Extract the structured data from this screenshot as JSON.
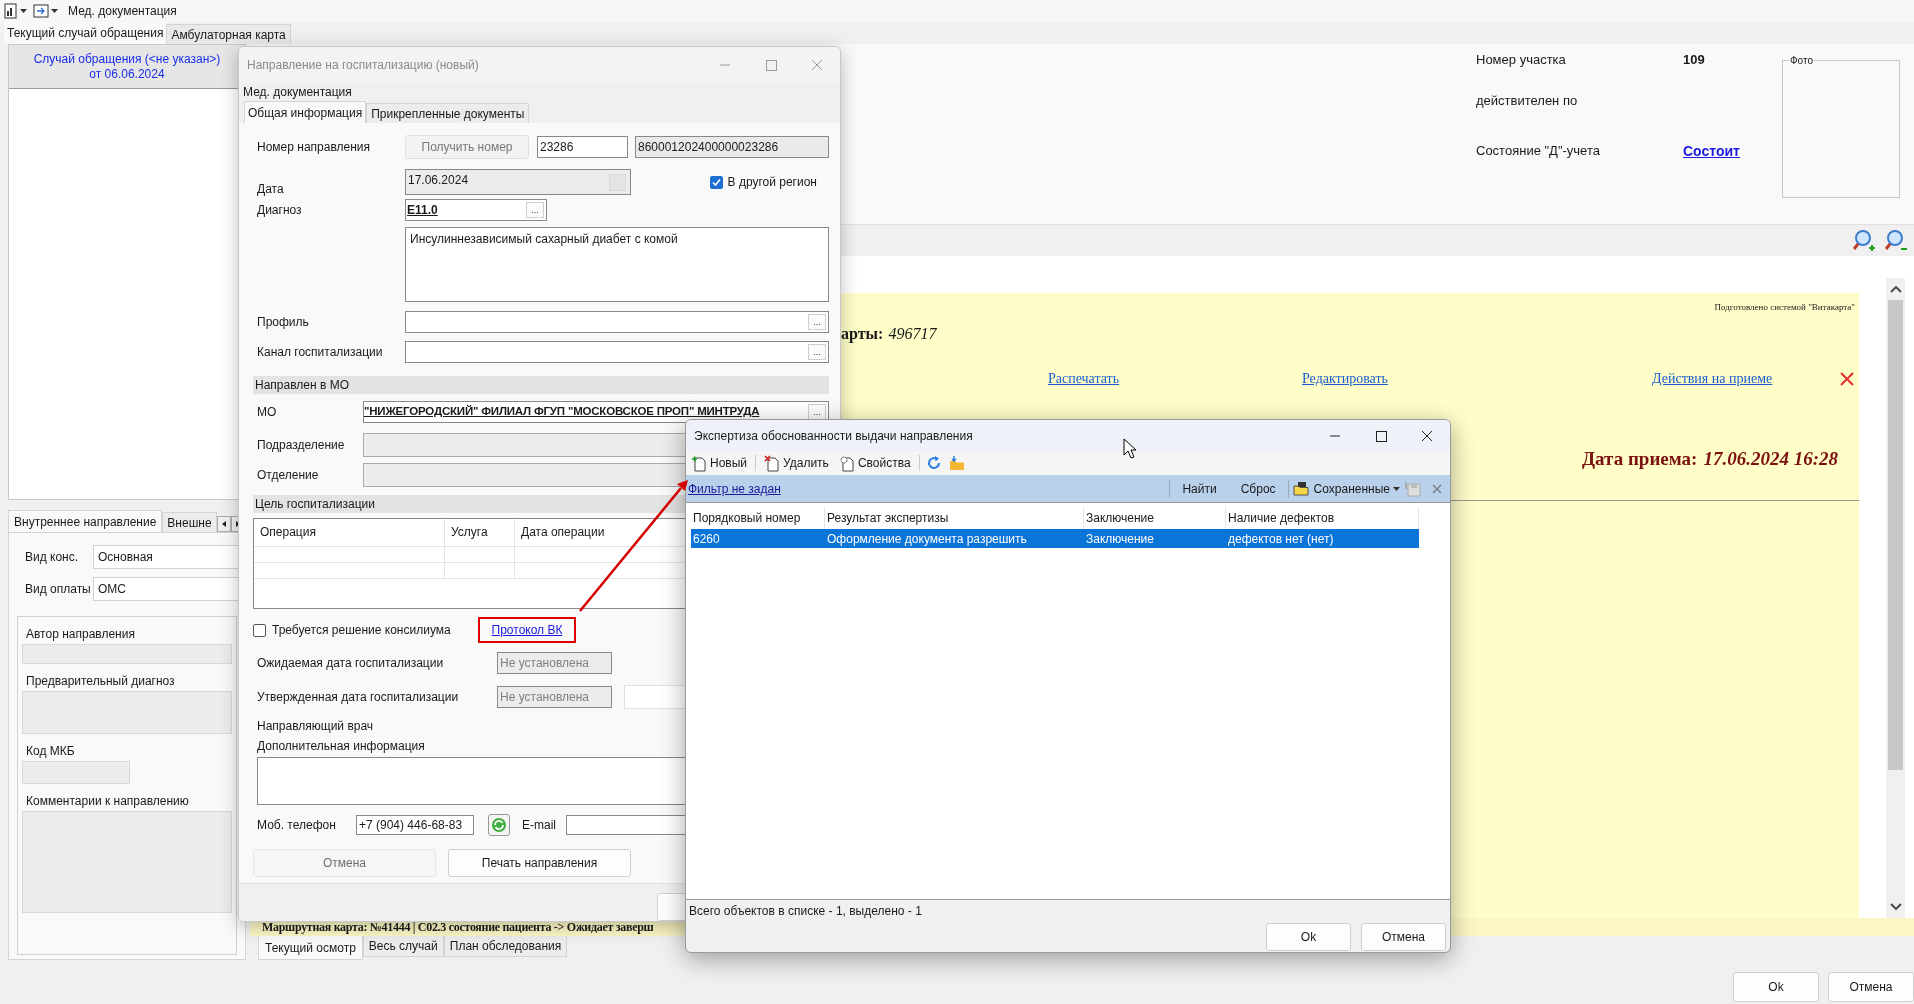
{
  "menu_bar": {
    "title": "Мед. документация"
  },
  "main_tabs": [
    {
      "label": "Текущий случай обращения",
      "selected": true
    },
    {
      "label": "Амбулаторная карта",
      "selected": false
    }
  ],
  "case_header": {
    "line1": "Случай обращения (<не указан>)",
    "line2": "от 06.06.2024"
  },
  "referral_tabs": [
    {
      "label": "Внутреннее направление",
      "selected": true
    },
    {
      "label": "Внешне",
      "selected": false
    }
  ],
  "referral_fields": [
    {
      "label": "Вид конс.",
      "value": "Основная"
    },
    {
      "label": "Вид оплаты",
      "value": "ОМС"
    }
  ],
  "referral_sections": [
    {
      "label": "Автор направления",
      "kind": "short"
    },
    {
      "label": "Предварительный диагноз",
      "kind": "tall"
    },
    {
      "label": "Код МКБ",
      "kind": "narrow"
    },
    {
      "label": "Комментарии к направлению",
      "kind": "large"
    }
  ],
  "patient_info": [
    {
      "label": "Номер участка",
      "value": "109",
      "kind": "bold"
    },
    {
      "label": "действителен по",
      "kind": "empty"
    },
    {
      "label": "Состояние \"Д\"-учета",
      "value": "Состоит",
      "kind": "link"
    }
  ],
  "photo": {
    "label": "Фото"
  },
  "document": {
    "system_note": "Подготовлено системой \"Витакарта\"",
    "card_label": "арты:",
    "card_number": "496717",
    "links": [
      "Распечатать",
      "Редактировать",
      "Действия на приеме"
    ],
    "visit_label": "Дата приема:",
    "visit_date": "17.06.2024 16:28",
    "route_card": "Маршрутная карта: №41444 | C02.3 состояние пациента -> Ожидает заверш"
  },
  "view_tabs": [
    {
      "label": "Текущий осмотр",
      "selected": true
    },
    {
      "label": "Весь случай",
      "selected": false
    },
    {
      "label": "План обследования",
      "selected": false
    }
  ],
  "footer_buttons": [
    "Ok",
    "Отмена"
  ],
  "referral_dialog": {
    "title": "Направление на госпитализацию (новый)",
    "menu": "Мед. документация",
    "tabs": [
      {
        "label": "Общая информация",
        "selected": true
      },
      {
        "label": "Прикрепленные документы",
        "selected": false
      }
    ],
    "number": {
      "label": "Номер направления",
      "button": "Получить номер",
      "value": "23286",
      "full_number": "860001202400000023286"
    },
    "date": {
      "label": "Дата",
      "value": "17.06.2024"
    },
    "other_region": {
      "label": "В другой регион",
      "checked": true
    },
    "diagnosis": {
      "label": "Диагноз",
      "code": "E11.0",
      "button": "...",
      "text": "Инсулиннезависимый сахарный диабет с комой"
    },
    "profile": {
      "label": "Профиль",
      "button": "..."
    },
    "channel": {
      "label": "Канал госпитализации",
      "button": "..."
    },
    "mo_section": "Направлен в МО",
    "mo": {
      "label": "МО",
      "value": "\"НИЖЕГОРОДСКИЙ\" ФИЛИАЛ ФГУП \"МОСКОВСКОЕ ПРОП\" МИНТРУДА",
      "button": "..."
    },
    "subdivision_label": "Подразделение",
    "department_label": "Отделение",
    "goal_section": "Цель госпитализации",
    "goal_columns": [
      "Операция",
      "Услуга",
      "Дата операции"
    ],
    "council": {
      "label": "Требуется решение консилиума",
      "checked": false
    },
    "protocol_link": "Протокол ВК",
    "expected_date": {
      "label": "Ожидаемая дата госпитализации",
      "placeholder": "Не установлена"
    },
    "approved_date": {
      "label": "Утвержденная дата госпитализации",
      "placeholder": "Не установлена"
    },
    "doctor_label": "Направляющий врач",
    "extra_label": "Дополнительная информация",
    "phone": {
      "label": "Моб. телефон",
      "value": "+7 (904) 446-68-83"
    },
    "email_label": "E-mail",
    "buttons": [
      {
        "label": "Отмена",
        "disabled": true
      },
      {
        "label": "Печать направления",
        "disabled": false
      }
    ]
  },
  "expertise_dialog": {
    "title": "Экспертиза обоснованности выдачи направления",
    "toolbar": [
      {
        "label": "Новый",
        "kind": "new"
      },
      {
        "label": "Удалить",
        "kind": "delete"
      },
      {
        "label": "Свойства",
        "kind": "properties"
      }
    ],
    "filter_link": "Фильтр не задан",
    "filter_buttons": [
      "Найти",
      "Сброс"
    ],
    "saved": "Сохраненные",
    "columns": [
      "Порядковый номер",
      "Результат экспертизы",
      "Заключение",
      "Наличие дефектов"
    ],
    "rows": [
      {
        "cells": [
          "6260",
          "Оформление документа разрешить",
          "Заключение",
          "дефектов нет (нет)"
        ],
        "selected": true
      }
    ],
    "status": "Всего объектов в списке - 1, выделено - 1",
    "buttons": [
      "Ok",
      "Отмена"
    ]
  }
}
